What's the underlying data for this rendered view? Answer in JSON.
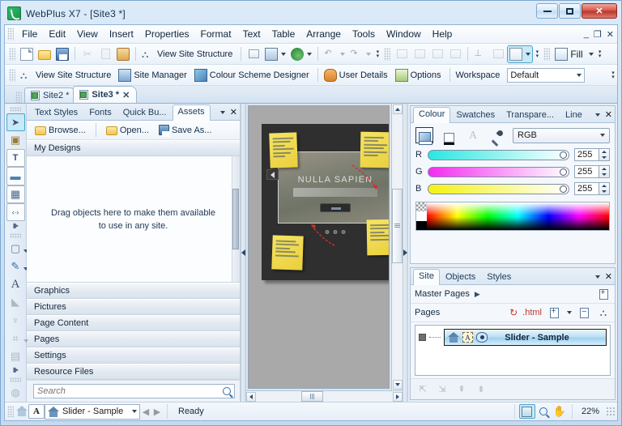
{
  "window": {
    "title": "WebPlus X7 - [Site3 *]",
    "app_icon": "webplus-logo-icon",
    "minimize": "minimize-icon",
    "maximize": "maximize-icon",
    "close": "close-icon"
  },
  "menu": {
    "items": [
      "File",
      "Edit",
      "View",
      "Insert",
      "Properties",
      "Format",
      "Text",
      "Table",
      "Arrange",
      "Tools",
      "Window",
      "Help"
    ],
    "mdi_minimize": "_",
    "mdi_restore": "❐",
    "mdi_close": "✕"
  },
  "toolbar_main": {
    "buttons": [
      {
        "name": "new-icon",
        "icon": "doc"
      },
      {
        "name": "open-icon",
        "icon": "folder"
      },
      {
        "name": "save-icon",
        "icon": "save"
      },
      {
        "name": "cut-icon",
        "icon": "scissors"
      },
      {
        "name": "copy-icon",
        "icon": "copy"
      },
      {
        "name": "paste-icon",
        "icon": "paste"
      }
    ],
    "view_site_structure": "View Site Structure",
    "html_code": "html-code-icon",
    "preview": "preview-monitor-icon",
    "publish": "publish-globe-icon",
    "undo": "undo-icon",
    "redo": "redo-icon",
    "fill_label": "Fill"
  },
  "toolbar_second": {
    "view_site_structure": "View Site Structure",
    "site_manager": "Site Manager",
    "colour_scheme_designer": "Colour Scheme Designer",
    "user_details": "User Details",
    "options": "Options",
    "workspace_label": "Workspace",
    "workspace_value": "Default"
  },
  "doc_tabs": [
    {
      "label": "Site2 *",
      "active": false
    },
    {
      "label": "Site3 *",
      "active": true,
      "close": "✕"
    }
  ],
  "assets_panel": {
    "tabs": [
      "Text Styles",
      "Fonts",
      "Quick Bu...",
      "Assets"
    ],
    "active_tab": "Assets",
    "menu_icon": "panel-menu-icon",
    "close_icon": "close-icon",
    "actions": [
      {
        "label": "Browse...",
        "icon": "folder-icon"
      },
      {
        "label": "Open...",
        "icon": "open-folder-icon"
      },
      {
        "label": "Save As...",
        "icon": "save-icon"
      }
    ],
    "sections_top": [
      "My Designs"
    ],
    "drop_hint_line1": "Drag objects here to make them available",
    "drop_hint_line2": "to use in any site.",
    "sections_bottom": [
      "Graphics",
      "Pictures",
      "Page Content",
      "Pages",
      "Settings",
      "Resource Files"
    ],
    "search_placeholder": "Search",
    "search_value": "",
    "search_icon": "search-icon"
  },
  "left_tools": [
    {
      "name": "pointer-tool",
      "glyph": "➤",
      "selected": true
    },
    {
      "name": "asset-box-tool",
      "glyph": "▣",
      "selected": false
    },
    {
      "name": "text-tool",
      "glyph": "T",
      "selected": false
    },
    {
      "name": "picture-tool",
      "glyph": "▬",
      "selected": false
    },
    {
      "name": "table-tool",
      "glyph": "▦",
      "selected": false
    },
    {
      "name": "html-fragment-tool",
      "glyph": "‹›",
      "selected": false
    },
    {
      "name": "shape-tool",
      "glyph": "▢",
      "selected": false
    },
    {
      "name": "pencil-tool",
      "glyph": "✎",
      "selected": false
    },
    {
      "name": "artistic-text-tool",
      "glyph": "A",
      "selected": false
    },
    {
      "name": "fill-tool",
      "glyph": "◢",
      "selected": false,
      "dim": true
    },
    {
      "name": "transparency-tool",
      "glyph": "♉",
      "selected": false,
      "dim": true
    },
    {
      "name": "crop-tool",
      "glyph": "⌗",
      "selected": false,
      "dim": true
    },
    {
      "name": "mesh-warp-tool",
      "glyph": "▤",
      "selected": false,
      "dim": true
    },
    {
      "name": "rotate-tool",
      "glyph": "◔",
      "selected": false,
      "dim": true
    }
  ],
  "canvas": {
    "page_title": "NULLA SAPIEN",
    "prev_arrow": "prev-slide-arrow",
    "next_arrow": "next-slide-arrow",
    "dots_count": 3
  },
  "colour_panel": {
    "tabs": [
      "Colour",
      "Swatches",
      "Transpare...",
      "Line"
    ],
    "active_tab": "Colour",
    "menu_icon": "panel-menu-icon",
    "close_icon": "close-icon",
    "mode_fill": "fill-colour-icon",
    "mode_line": "line-colour-icon",
    "mode_text": "text-colour-icon",
    "eyedropper": "eyedropper-icon",
    "model": "RGB",
    "channels": [
      {
        "label": "R",
        "value": "255"
      },
      {
        "label": "G",
        "value": "255"
      },
      {
        "label": "B",
        "value": "255"
      }
    ]
  },
  "site_panel": {
    "tabs": [
      "Site",
      "Objects",
      "Styles"
    ],
    "active_tab": "Site",
    "menu_icon": "panel-menu-icon",
    "close_icon": "close-icon",
    "master_pages_label": "Master Pages",
    "master_pages_expand": "expand-arrow-icon",
    "add_master_page": "add-master-page-icon",
    "pages_label": "Pages",
    "html_refresh": "refresh-icon",
    "html_label": ".html",
    "add_page": "add-page-icon",
    "remove_page": "remove-page-icon",
    "site_structure": "site-structure-icon",
    "page_item": {
      "name": "Slider - Sample",
      "home_icon": "home-page-icon",
      "text_icon": "text-marker-icon",
      "visible_icon": "visible-eye-icon"
    },
    "footer_buttons": [
      "promote-page-icon",
      "demote-page-icon",
      "move-up-icon",
      "move-down-icon"
    ]
  },
  "statusbar": {
    "home_icon": "home-icon",
    "text_icon": "artistic-text-icon",
    "page_selector": "Slider - Sample",
    "prev_page": "prev-page-arrow",
    "next_page": "next-page-arrow",
    "status_text": "Ready",
    "tools": [
      {
        "name": "page-locator-tool",
        "active": true
      },
      {
        "name": "zoom-tool",
        "active": false
      },
      {
        "name": "pan-tool",
        "active": false
      }
    ],
    "zoom_level": "22%"
  }
}
